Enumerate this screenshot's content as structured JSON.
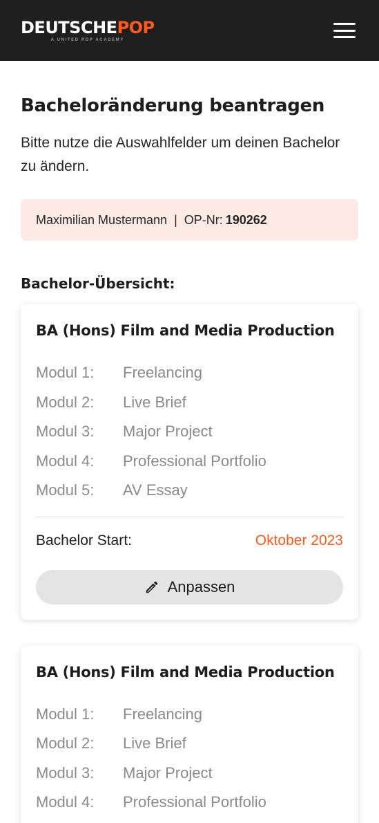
{
  "header": {
    "logo_part1": "DEUTSCHE",
    "logo_part2": "POP",
    "logo_subtitle": "A UNITED POP ACADEMY",
    "menu_icon": "hamburger-menu-icon"
  },
  "page": {
    "title": "Bacheloränderung beantragen",
    "intro": "Bitte nutze die Auswahlfelder um deinen Bachelor zu ändern."
  },
  "user": {
    "name": "Maximilian Mustermann",
    "separator": "|",
    "op_label": "OP-Nr:",
    "op_number": "190262"
  },
  "overview": {
    "title": "Bachelor-Übersicht:"
  },
  "cards": [
    {
      "title": "BA (Hons) Film and Media Production",
      "modules": [
        {
          "label": "Modul 1:",
          "value": "Freelancing"
        },
        {
          "label": "Modul 2:",
          "value": "Live Brief"
        },
        {
          "label": "Modul 3:",
          "value": "Major Project"
        },
        {
          "label": "Modul 4:",
          "value": "Professional Portfolio"
        },
        {
          "label": "Modul 5:",
          "value": "AV Essay"
        }
      ],
      "start_label": "Bachelor Start:",
      "start_value": "Oktober 2023",
      "button_label": "Anpassen",
      "button_icon": "pencil-icon"
    },
    {
      "title": "BA (Hons) Film and Media Production",
      "modules": [
        {
          "label": "Modul 1:",
          "value": "Freelancing"
        },
        {
          "label": "Modul 2:",
          "value": "Live Brief"
        },
        {
          "label": "Modul 3:",
          "value": "Major Project"
        },
        {
          "label": "Modul 4:",
          "value": "Professional Portfolio"
        }
      ]
    }
  ],
  "colors": {
    "accent": "#ff5a1f",
    "header_bg": "#1f1f1f",
    "user_box_bg": "#fdeae4",
    "button_bg": "#e4e4e4"
  }
}
